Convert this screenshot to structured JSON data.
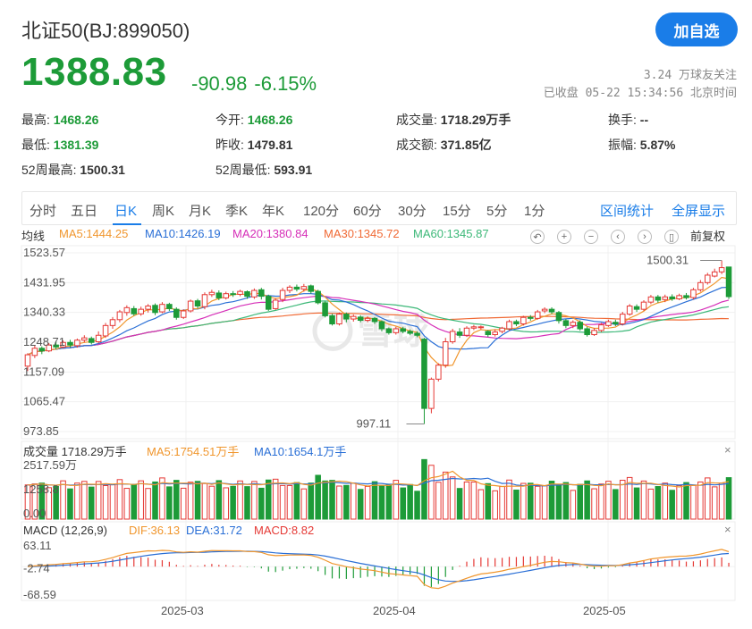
{
  "header": {
    "title": "北证50(BJ:899050)",
    "add_button": "加自选",
    "price": "1388.83",
    "change": "-90.98",
    "change_pct": "-6.15%",
    "followers": "3.24 万球友关注",
    "status": "已收盘 05-22 15:34:56 北京时间"
  },
  "stats": [
    {
      "label": "最高:",
      "value": "1468.26",
      "green": true
    },
    {
      "label": "今开:",
      "value": "1468.26",
      "green": true
    },
    {
      "label": "成交量:",
      "value": "1718.29万手",
      "green": false
    },
    {
      "label": "换手:",
      "value": "--",
      "green": false
    },
    {
      "label": "最低:",
      "value": "1381.39",
      "green": true
    },
    {
      "label": "昨收:",
      "value": "1479.81",
      "green": false
    },
    {
      "label": "成交额:",
      "value": "371.85亿",
      "green": false
    },
    {
      "label": "振幅:",
      "value": "5.87%",
      "green": false
    },
    {
      "label": "52周最高:",
      "value": "1500.31",
      "green": false
    },
    {
      "label": "52周最低:",
      "value": "593.91",
      "green": false
    }
  ],
  "tabs": [
    "分时",
    "五日",
    "日K",
    "周K",
    "月K",
    "季K",
    "年K",
    "120分",
    "60分",
    "30分",
    "15分",
    "5分",
    "1分"
  ],
  "active_tab": "日K",
  "tab_right": [
    "区间统计",
    "全屏显示"
  ],
  "ma_legend": {
    "label": "均线",
    "items": [
      {
        "text": "MA5:1444.25",
        "color": "#f0962d"
      },
      {
        "text": "MA10:1426.19",
        "color": "#2a6fd6"
      },
      {
        "text": "MA20:1380.84",
        "color": "#d62fb8"
      },
      {
        "text": "MA30:1345.72",
        "color": "#f06a35"
      },
      {
        "text": "MA60:1345.87",
        "color": "#3cb878"
      }
    ]
  },
  "controls": {
    "icons": [
      "undo-icon",
      "zoom-in-icon",
      "zoom-out-icon",
      "prev-icon",
      "next-icon",
      "candle-icon"
    ],
    "adjust": "前复权"
  },
  "volume_legend": {
    "label": "成交量 1718.29万手",
    "items": [
      {
        "text": "MA5:1754.51万手",
        "color": "#f0962d"
      },
      {
        "text": "MA10:1654.1万手",
        "color": "#2a6fd6"
      }
    ]
  },
  "macd_legend": {
    "label": "MACD (12,26,9)",
    "items": [
      {
        "text": "DIF:36.13",
        "color": "#f0962d"
      },
      {
        "text": "DEA:31.72",
        "color": "#2a6fd6"
      },
      {
        "text": "MACD:8.82",
        "color": "#e53935"
      }
    ]
  },
  "watermark": "雪球",
  "colors": {
    "up": "#e53935",
    "down": "#1d9b38",
    "accent": "#1a7de8"
  },
  "chart_data": {
    "type": "candlestick",
    "price_axis_ticks": [
      "1523.57",
      "1431.95",
      "1340.33",
      "1248.71",
      "1157.09",
      "1065.47",
      "973.85"
    ],
    "ylim": [
      973.85,
      1523.57
    ],
    "x_tick_labels": [
      "2025-03",
      "2025-04",
      "2025-05"
    ],
    "annotations": {
      "high": "1500.31",
      "low": "997.11"
    },
    "candles": [
      [
        1175,
        1210,
        1160,
        1215
      ],
      [
        1208,
        1230,
        1200,
        1240
      ],
      [
        1230,
        1222,
        1212,
        1236
      ],
      [
        1222,
        1240,
        1218,
        1246
      ],
      [
        1240,
        1234,
        1226,
        1252
      ],
      [
        1234,
        1248,
        1230,
        1254
      ],
      [
        1248,
        1240,
        1232,
        1256
      ],
      [
        1238,
        1255,
        1232,
        1260
      ],
      [
        1255,
        1262,
        1248,
        1270
      ],
      [
        1260,
        1248,
        1242,
        1266
      ],
      [
        1250,
        1270,
        1245,
        1282
      ],
      [
        1268,
        1300,
        1262,
        1308
      ],
      [
        1300,
        1318,
        1290,
        1326
      ],
      [
        1318,
        1342,
        1310,
        1348
      ],
      [
        1340,
        1355,
        1330,
        1362
      ],
      [
        1352,
        1336,
        1330,
        1360
      ],
      [
        1336,
        1350,
        1330,
        1358
      ],
      [
        1350,
        1360,
        1340,
        1366
      ],
      [
        1362,
        1340,
        1332,
        1368
      ],
      [
        1342,
        1365,
        1338,
        1372
      ],
      [
        1365,
        1352,
        1345,
        1370
      ],
      [
        1350,
        1325,
        1318,
        1356
      ],
      [
        1325,
        1345,
        1320,
        1350
      ],
      [
        1345,
        1375,
        1340,
        1380
      ],
      [
        1376,
        1360,
        1352,
        1382
      ],
      [
        1358,
        1395,
        1350,
        1402
      ],
      [
        1395,
        1402,
        1388,
        1410
      ],
      [
        1400,
        1385,
        1378,
        1408
      ],
      [
        1385,
        1398,
        1380,
        1404
      ],
      [
        1398,
        1396,
        1388,
        1406
      ],
      [
        1396,
        1405,
        1390,
        1410
      ],
      [
        1404,
        1390,
        1382,
        1408
      ],
      [
        1388,
        1408,
        1382,
        1414
      ],
      [
        1410,
        1390,
        1380,
        1416
      ],
      [
        1390,
        1350,
        1345,
        1395
      ],
      [
        1352,
        1378,
        1348,
        1384
      ],
      [
        1380,
        1408,
        1372,
        1416
      ],
      [
        1408,
        1418,
        1400,
        1424
      ],
      [
        1418,
        1412,
        1405,
        1426
      ],
      [
        1412,
        1420,
        1404,
        1428
      ],
      [
        1422,
        1405,
        1398,
        1426
      ],
      [
        1405,
        1370,
        1365,
        1410
      ],
      [
        1370,
        1330,
        1325,
        1374
      ],
      [
        1330,
        1305,
        1300,
        1336
      ],
      [
        1305,
        1335,
        1300,
        1340
      ],
      [
        1335,
        1320,
        1310,
        1340
      ],
      [
        1320,
        1328,
        1312,
        1334
      ],
      [
        1326,
        1316,
        1310,
        1332
      ],
      [
        1316,
        1322,
        1310,
        1328
      ],
      [
        1322,
        1312,
        1305,
        1326
      ],
      [
        1312,
        1290,
        1282,
        1316
      ],
      [
        1290,
        1278,
        1272,
        1294
      ],
      [
        1278,
        1290,
        1272,
        1296
      ],
      [
        1290,
        1282,
        1276,
        1296
      ],
      [
        1282,
        1276,
        1270,
        1288
      ],
      [
        1276,
        1270,
        1264,
        1282
      ],
      [
        1258,
        1045,
        997.11,
        1262
      ],
      [
        1045,
        1135,
        1030,
        1140
      ],
      [
        1135,
        1178,
        1128,
        1184
      ],
      [
        1178,
        1250,
        1170,
        1262
      ],
      [
        1250,
        1282,
        1244,
        1290
      ],
      [
        1280,
        1270,
        1262,
        1292
      ],
      [
        1270,
        1292,
        1265,
        1298
      ],
      [
        1292,
        1296,
        1286,
        1302
      ],
      [
        1296,
        1296,
        1288,
        1300
      ],
      [
        1282,
        1272,
        1265,
        1286
      ],
      [
        1272,
        1280,
        1266,
        1288
      ],
      [
        1282,
        1292,
        1276,
        1296
      ],
      [
        1290,
        1312,
        1284,
        1318
      ],
      [
        1312,
        1305,
        1298,
        1318
      ],
      [
        1305,
        1325,
        1300,
        1330
      ],
      [
        1325,
        1322,
        1315,
        1332
      ],
      [
        1322,
        1342,
        1318,
        1348
      ],
      [
        1345,
        1350,
        1338,
        1356
      ],
      [
        1350,
        1342,
        1335,
        1356
      ],
      [
        1340,
        1315,
        1306,
        1345
      ],
      [
        1315,
        1300,
        1292,
        1320
      ],
      [
        1300,
        1310,
        1292,
        1316
      ],
      [
        1310,
        1290,
        1284,
        1316
      ],
      [
        1290,
        1272,
        1266,
        1296
      ],
      [
        1272,
        1285,
        1268,
        1292
      ],
      [
        1285,
        1302,
        1280,
        1308
      ],
      [
        1300,
        1312,
        1296,
        1318
      ],
      [
        1310,
        1305,
        1298,
        1318
      ],
      [
        1305,
        1335,
        1300,
        1342
      ],
      [
        1335,
        1360,
        1330,
        1366
      ],
      [
        1358,
        1350,
        1342,
        1365
      ],
      [
        1350,
        1372,
        1345,
        1378
      ],
      [
        1372,
        1388,
        1366,
        1394
      ],
      [
        1388,
        1378,
        1370,
        1394
      ],
      [
        1380,
        1388,
        1372,
        1395
      ],
      [
        1388,
        1382,
        1376,
        1396
      ],
      [
        1382,
        1392,
        1378,
        1398
      ],
      [
        1392,
        1386,
        1380,
        1400
      ],
      [
        1386,
        1410,
        1380,
        1416
      ],
      [
        1410,
        1432,
        1404,
        1440
      ],
      [
        1432,
        1455,
        1426,
        1462
      ],
      [
        1452,
        1465,
        1448,
        1475
      ],
      [
        1465,
        1478,
        1458,
        1500.31
      ],
      [
        1480,
        1388.83,
        1381.39,
        1468.26
      ]
    ],
    "volume_axis_ticks": [
      "2517.59万",
      "1258.8",
      "0.00"
    ],
    "volume_max": 2517.59,
    "volume_latest": 1718.29,
    "volume_legend": {
      "MA5": 1754.51,
      "MA10": 1654.1
    },
    "macd_axis_ticks": [
      "63.11",
      "-2.74",
      "-68.59"
    ],
    "macd_range": [
      -68.59,
      63.11
    ],
    "macd_latest": {
      "DIF": 36.13,
      "DEA": 31.72,
      "MACD": 8.82
    }
  }
}
